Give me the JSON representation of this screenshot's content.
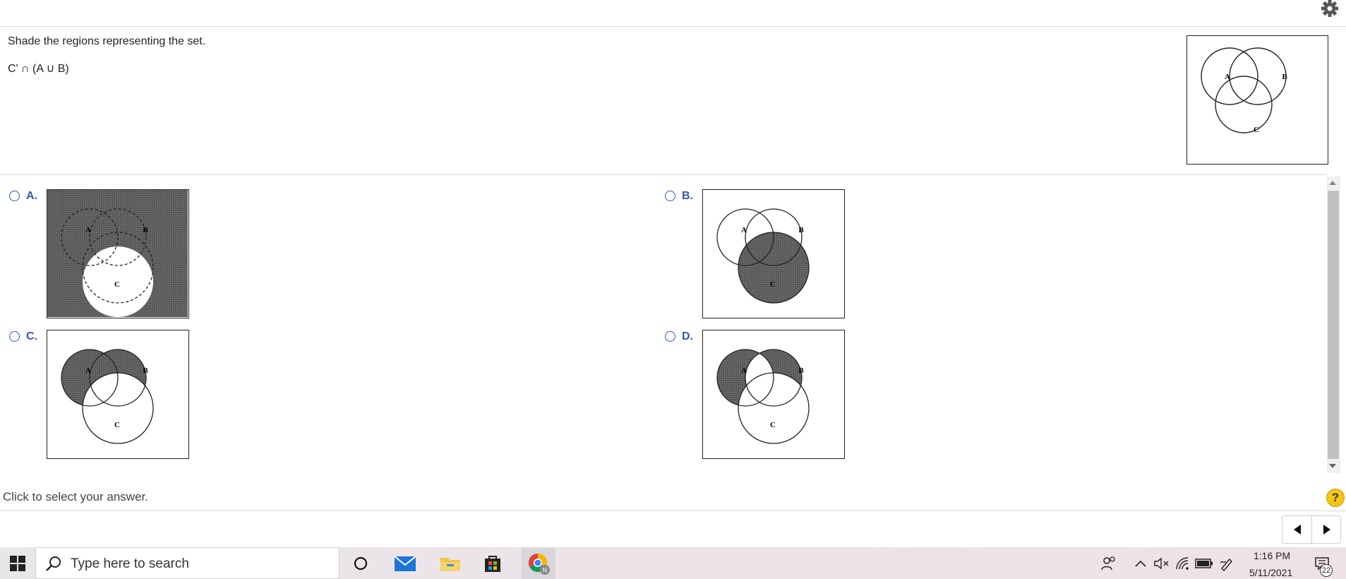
{
  "question": {
    "instruction": "Shade the regions representing the set.",
    "expression": "C' ∩ (A ∪ B)"
  },
  "venn_labels": {
    "a": "A",
    "b": "B",
    "c": "C"
  },
  "options": [
    {
      "letter": "A.",
      "shading": "complement of C"
    },
    {
      "letter": "B.",
      "shading": "C only"
    },
    {
      "letter": "C.",
      "shading": "(A ∪ B) outside C"
    },
    {
      "letter": "D.",
      "shading": "(A ∪ B) outside C, excluding A ∩ B"
    }
  ],
  "footer": {
    "hint": "Click to select your answer.",
    "help_label": "?"
  },
  "taskbar": {
    "search_placeholder": "Type here to search",
    "time": "1:16 PM",
    "date": "5/11/2021",
    "notification_count": "22",
    "chrome_badge": "N"
  },
  "colors": {
    "accent": "#2e5aa8",
    "shade": "#555555",
    "help": "#f5c518"
  }
}
